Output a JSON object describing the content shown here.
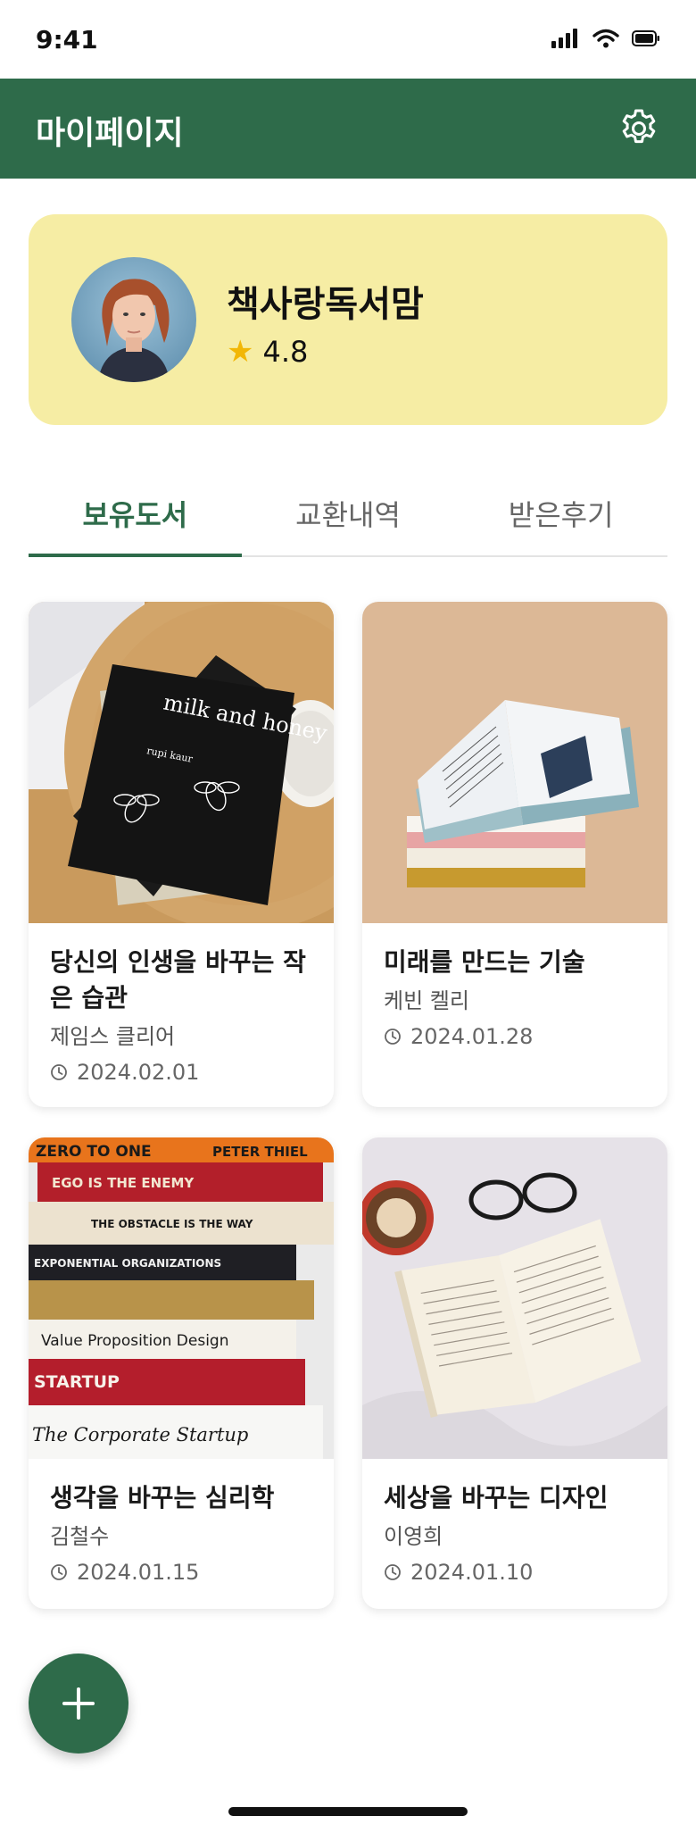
{
  "status_bar": {
    "time": "9:41"
  },
  "header": {
    "title": "마이페이지",
    "settings_icon": "gear-icon"
  },
  "profile": {
    "nickname": "책사랑독서맘",
    "rating": "4.8"
  },
  "tabs": [
    {
      "label": "보유도서",
      "active": true
    },
    {
      "label": "교환내역",
      "active": false
    },
    {
      "label": "받은후기",
      "active": false
    }
  ],
  "books": [
    {
      "title": "당신의 인생을 바꾸는 작은 습관",
      "author": "제임스 클리어",
      "date": "2024.02.01"
    },
    {
      "title": "미래를 만드는 기술",
      "author": "케빈 켈리",
      "date": "2024.01.28"
    },
    {
      "title": "생각을 바꾸는 심리학",
      "author": "김철수",
      "date": "2024.01.15"
    },
    {
      "title": "세상을 바꾸는 디자인",
      "author": "이영희",
      "date": "2024.01.10"
    }
  ],
  "book_covers": {
    "book1_title": "milk and honey",
    "book1_author": "rupi kaur",
    "book3_spines": [
      "ZERO TO ONE",
      "PETER THIEL",
      "EGO IS THE ENEMY",
      "THE OBSTACLE IS THE WAY",
      "EXPONENTIAL ORGANIZATIONS",
      "Value Proposition Design",
      "STARTUP",
      "The Corporate Startup"
    ]
  },
  "fab": {
    "icon": "plus-icon"
  },
  "colors": {
    "primary": "#2e6b4a",
    "profile_bg": "#f6eda4",
    "star": "#f2b705"
  }
}
